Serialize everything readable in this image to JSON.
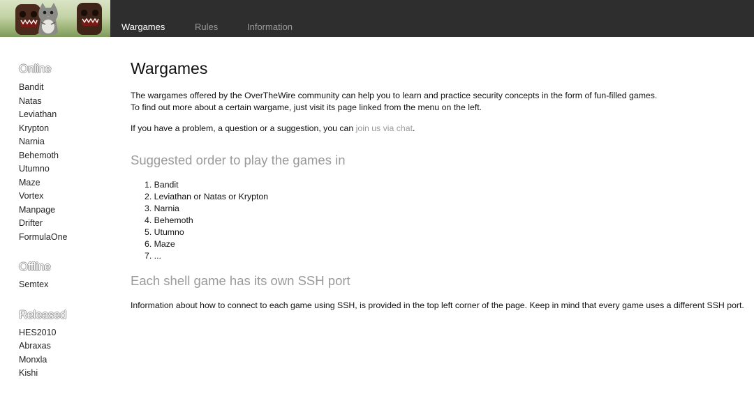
{
  "nav": {
    "items": [
      {
        "label": "Wargames",
        "active": true
      },
      {
        "label": "Rules",
        "active": false
      },
      {
        "label": "Information",
        "active": false
      }
    ]
  },
  "sidebar": {
    "sections": [
      {
        "heading": "Online",
        "items": [
          "Bandit",
          "Natas",
          "Leviathan",
          "Krypton",
          "Narnia",
          "Behemoth",
          "Utumno",
          "Maze",
          "Vortex",
          "Manpage",
          "Drifter",
          "FormulaOne"
        ]
      },
      {
        "heading": "Offline",
        "items": [
          "Semtex"
        ]
      },
      {
        "heading": "Released",
        "items": [
          "HES2010",
          "Abraxas",
          "Monxla",
          "Kishi"
        ]
      }
    ]
  },
  "main": {
    "title": "Wargames",
    "intro_line1": "The wargames offered by the OverTheWire community can help you to learn and practice security concepts in the form of fun-filled games.",
    "intro_line2": "To find out more about a certain wargame, just visit its page linked from the menu on the left.",
    "help_prefix": "If you have a problem, a question or a suggestion, you can ",
    "help_link": "join us via chat",
    "help_suffix": ".",
    "order_heading": "Suggested order to play the games in",
    "order_list": [
      "1. Bandit",
      "2. Leviathan or Natas or Krypton",
      "3. Narnia",
      "4. Behemoth",
      "5. Utumno",
      "6. Maze",
      "7. ..."
    ],
    "ssh_heading": "Each shell game has its own SSH port",
    "ssh_text": "Information about how to connect to each game using SSH, is provided in the top left corner of the page. Keep in mind that every game uses a different SSH port."
  },
  "colors": {
    "topbar": "#2e2e2e",
    "nav_active": "#ffffff",
    "nav_inactive": "#9a9a9a",
    "link": "#9a9a9a",
    "subheading": "#9a9a9a"
  }
}
